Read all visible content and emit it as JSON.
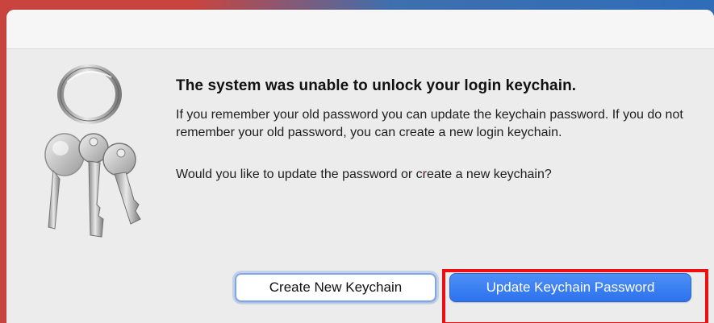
{
  "dialog": {
    "headline": "The system was unable to unlock your login keychain.",
    "message": "If you remember your old password you can update the keychain password. If you do not remember your old password, you can create a new login keychain.",
    "question": "Would you like to update the password or create a new keychain?"
  },
  "buttons": {
    "create_label": "Create New Keychain",
    "update_label": "Update Keychain Password"
  },
  "icon": {
    "name": "keychain-access-icon"
  },
  "colors": {
    "primary_button": "#2c72ec",
    "highlight": "#ee0f12",
    "dialog_bg": "#ececec"
  }
}
